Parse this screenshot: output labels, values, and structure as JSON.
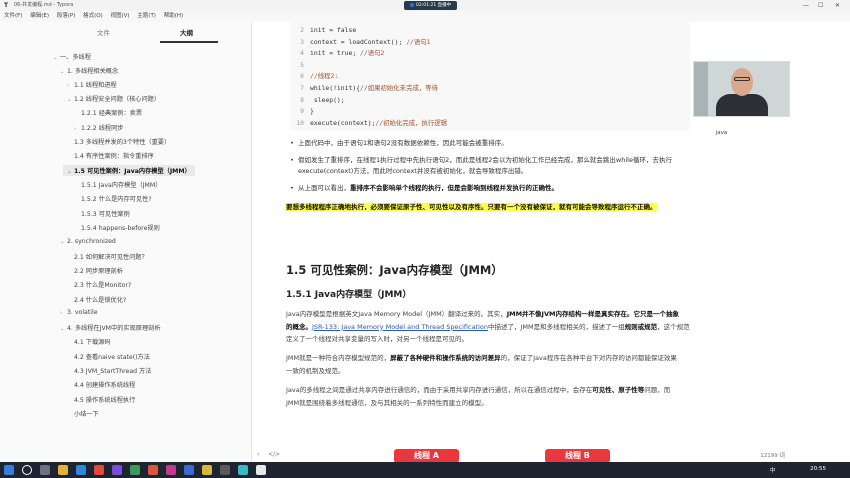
{
  "window": {
    "title": "06-并发编程.md - Typora",
    "minimize": "—",
    "maximize": "☐",
    "close": "✕"
  },
  "recording_badge": "02:01:21  直播中",
  "menu": [
    "文件(F)",
    "编辑(E)",
    "段落(P)",
    "格式(O)",
    "视图(V)",
    "主题(T)",
    "帮助(H)"
  ],
  "sidebar": {
    "tabs": [
      "文件",
      "大纲"
    ],
    "outline": [
      {
        "label": "一、多线程",
        "arrow": "⌄"
      },
      {
        "label": "1. 多线程相关概念",
        "arrow": "⌄"
      },
      {
        "label": "1.1 线程和进程",
        "arrow": "›"
      },
      {
        "label": "1.2 线程安全问题（核心问题）",
        "arrow": "⌄"
      },
      {
        "label": "1.2.1 经典案例：卖票",
        "arrow": ""
      },
      {
        "label": "1.2.2 线程同步",
        "arrow": "›"
      },
      {
        "label": "1.3 多线程并发的3个特性（重要）",
        "arrow": ""
      },
      {
        "label": "1.4 有序性案例：指令重排序",
        "arrow": ""
      },
      {
        "label": "1.5 可见性案例：Java内存模型（JMM）",
        "arrow": "⌄"
      },
      {
        "label": "1.5.1 Java内存模型（JMM）",
        "arrow": ""
      },
      {
        "label": "1.5.2 什么是内存可见性?",
        "arrow": ""
      },
      {
        "label": "1.5.3 可见性案例",
        "arrow": ""
      },
      {
        "label": "1.5.4 happens-before规则",
        "arrow": ""
      },
      {
        "label": "2. synchronized",
        "arrow": "⌄"
      },
      {
        "label": "2.1 如何解决可见性问题？",
        "arrow": ""
      },
      {
        "label": "2.2 同步原理剖析",
        "arrow": ""
      },
      {
        "label": "2.3 什么是Monitor?",
        "arrow": ""
      },
      {
        "label": "2.4 什么是锁优化?",
        "arrow": ""
      },
      {
        "label": "3. volatile",
        "arrow": "›"
      },
      {
        "label": "4. 多线程在JVM中的实现原理剖析",
        "arrow": "⌄"
      },
      {
        "label": "4.1 下载源码",
        "arrow": ""
      },
      {
        "label": "4.2 查看naive state()方法",
        "arrow": ""
      },
      {
        "label": "4.3 JVM_StartThread 方法",
        "arrow": ""
      },
      {
        "label": "4.4 创建操作系统线程",
        "arrow": ""
      },
      {
        "label": "4.5 操作系统线程执行",
        "arrow": ""
      },
      {
        "label": "小结一下",
        "arrow": ""
      }
    ]
  },
  "code": [
    {
      "n": "2",
      "text": "init = false",
      "comment": ""
    },
    {
      "n": "3",
      "text": "context = loadContext(); ",
      "comment": "//语句1"
    },
    {
      "n": "4",
      "text": "init = true; ",
      "comment": "//语句2"
    },
    {
      "n": "5",
      "text": "",
      "comment": ""
    },
    {
      "n": "6",
      "text": "",
      "comment": "//线程2:"
    },
    {
      "n": "7",
      "text": "while(!init){",
      "comment": "//如果初始化未完成，等待"
    },
    {
      "n": "8",
      "text": "  sleep();",
      "comment": ""
    },
    {
      "n": "9",
      "text": "}",
      "comment": ""
    },
    {
      "n": "10",
      "text": "execute(context);",
      "comment": "//初始化完成，执行逻辑"
    }
  ],
  "bullets": {
    "b1": "上面代码中，由于语句1和语句2没有数据依赖性，因此可能会被重排序。",
    "b2a": "假如发生了重排序，在线程1执行过程中先执行语句2，而此是线程2会以为初始化工作已经完成，那么就会跳出while循环，去执行",
    "b2b": "execute(context)方法，而此时context并没有被初始化，就会导致程序出错。",
    "b3_plain": "从上面可以看出，",
    "b3_bold": "重排序不会影响单个线程的执行，但是会影响到线程并发执行的正确性。",
    "highlight": "要想多线程程序正确地执行，必须要保证原子性、可见性以及有序性。只要有一个没有被保证，就有可能会导致程序运行不正确。"
  },
  "h2": "1.5 可见性案例：Java内存模型（JMM）",
  "h3": "1.5.1 Java内存模型（JMM）",
  "p1": {
    "a": "Java内存模型是根据英文Java Memory Model（JMM）翻译过来的。其实，",
    "b": "JMM并不像JVM内存结构一样是真实存在。它只是一个抽象",
    "c": "的概念。",
    "link": "JSR-133: Java Memory Model and Thread Specification",
    "d": "中描述了，JMM是和多线程相关的，描述了一组",
    "e": "规则或规范",
    "f": "，这个规范",
    "g": "定义了一个线程对共享变量的写入时，对另一个线程是可见的。"
  },
  "p2": {
    "a": "JMM就是一种符合内存模型规范的，",
    "b": "屏蔽了各种硬件和操作系统的访问差异",
    "c": "的，保证了Java程序在各种平台下对内存的访问都能保证效果",
    "d": "一致的机制及规范。"
  },
  "p3": {
    "a": "Java的多线程之间是通过共享内存进行通信的，而由于采用共享内存进行通信，所以在通信过程中，会存在",
    "b": "可见性、原子性等",
    "c": "问题，而",
    "d": "JMM就是围绕着多线程通信，及与其相关的一系列特性而建立的模型。"
  },
  "webcam_label": "java",
  "status": {
    "words": "12199 词",
    "left_icon": "‹",
    "code_icon": "</>"
  },
  "thread_buttons": [
    "线程 A",
    "线程 B"
  ],
  "taskbar": {
    "time": "20:55",
    "lang": "中"
  }
}
